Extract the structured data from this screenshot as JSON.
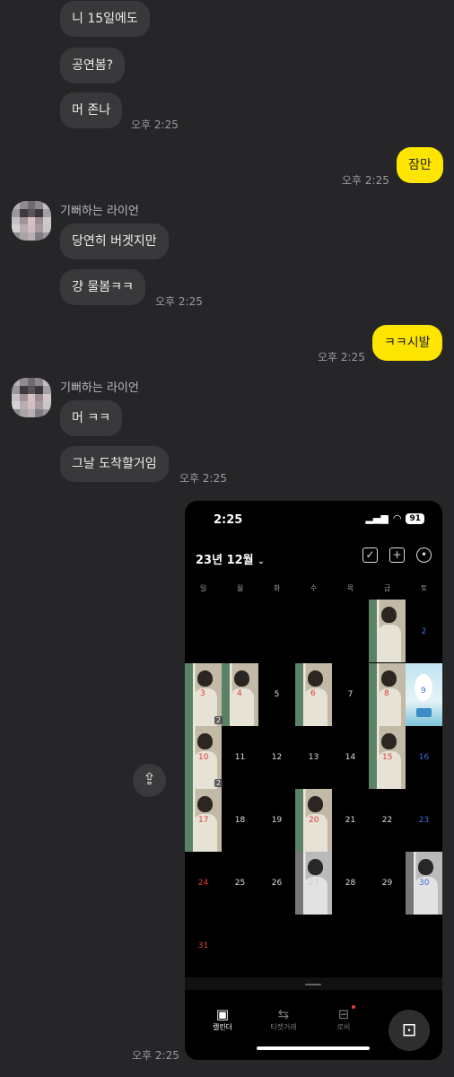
{
  "chat": {
    "friend_name": "기뻐하는 라이언",
    "messages": [
      {
        "text": "니 15일에도",
        "side": "left"
      },
      {
        "text": "공연봄?",
        "side": "left"
      },
      {
        "text": "머 존나",
        "side": "left",
        "time": "오후 2:25"
      },
      {
        "text": "잠만",
        "side": "right",
        "time": "오후 2:25"
      },
      {
        "text": "당연히 버겟지만",
        "side": "left"
      },
      {
        "text": "걍 물봄ㅋㅋ",
        "side": "left",
        "time": "오후 2:25"
      },
      {
        "text": "ㅋㅋ시발",
        "side": "right",
        "time": "오후 2:25"
      },
      {
        "text": "머 ㅋㅋ",
        "side": "left"
      },
      {
        "text": "그날 도착할거임",
        "side": "left",
        "time": "오후 2:25"
      }
    ],
    "image_time": "오후 2:25"
  },
  "screenshot": {
    "status_time": "2:25",
    "battery": "91",
    "month_label": "23년 12월",
    "weekdays": [
      "일",
      "월",
      "화",
      "수",
      "목",
      "금",
      "토"
    ],
    "days": {
      "d2": "2",
      "d3": "3",
      "d4": "4",
      "d5": "5",
      "d6": "6",
      "d7": "7",
      "d8": "8",
      "d9": "9",
      "d10": "10",
      "d11": "11",
      "d12": "12",
      "d13": "13",
      "d14": "14",
      "d15": "15",
      "d16": "16",
      "d17": "17",
      "d18": "18",
      "d19": "19",
      "d20": "20",
      "d21": "21",
      "d22": "22",
      "d23": "23",
      "d24": "24",
      "d25": "25",
      "d26": "26",
      "d27": "27",
      "d28": "28",
      "d29": "29",
      "d30": "30",
      "d31": "31"
    },
    "badges": {
      "b4": "2",
      "b10": "2"
    },
    "tabs": [
      "캘린더",
      "티켓거래",
      "로비"
    ],
    "colors": {
      "sunday": "#e23b3b",
      "saturday": "#3f6fe0",
      "accent": "#fee500"
    }
  }
}
